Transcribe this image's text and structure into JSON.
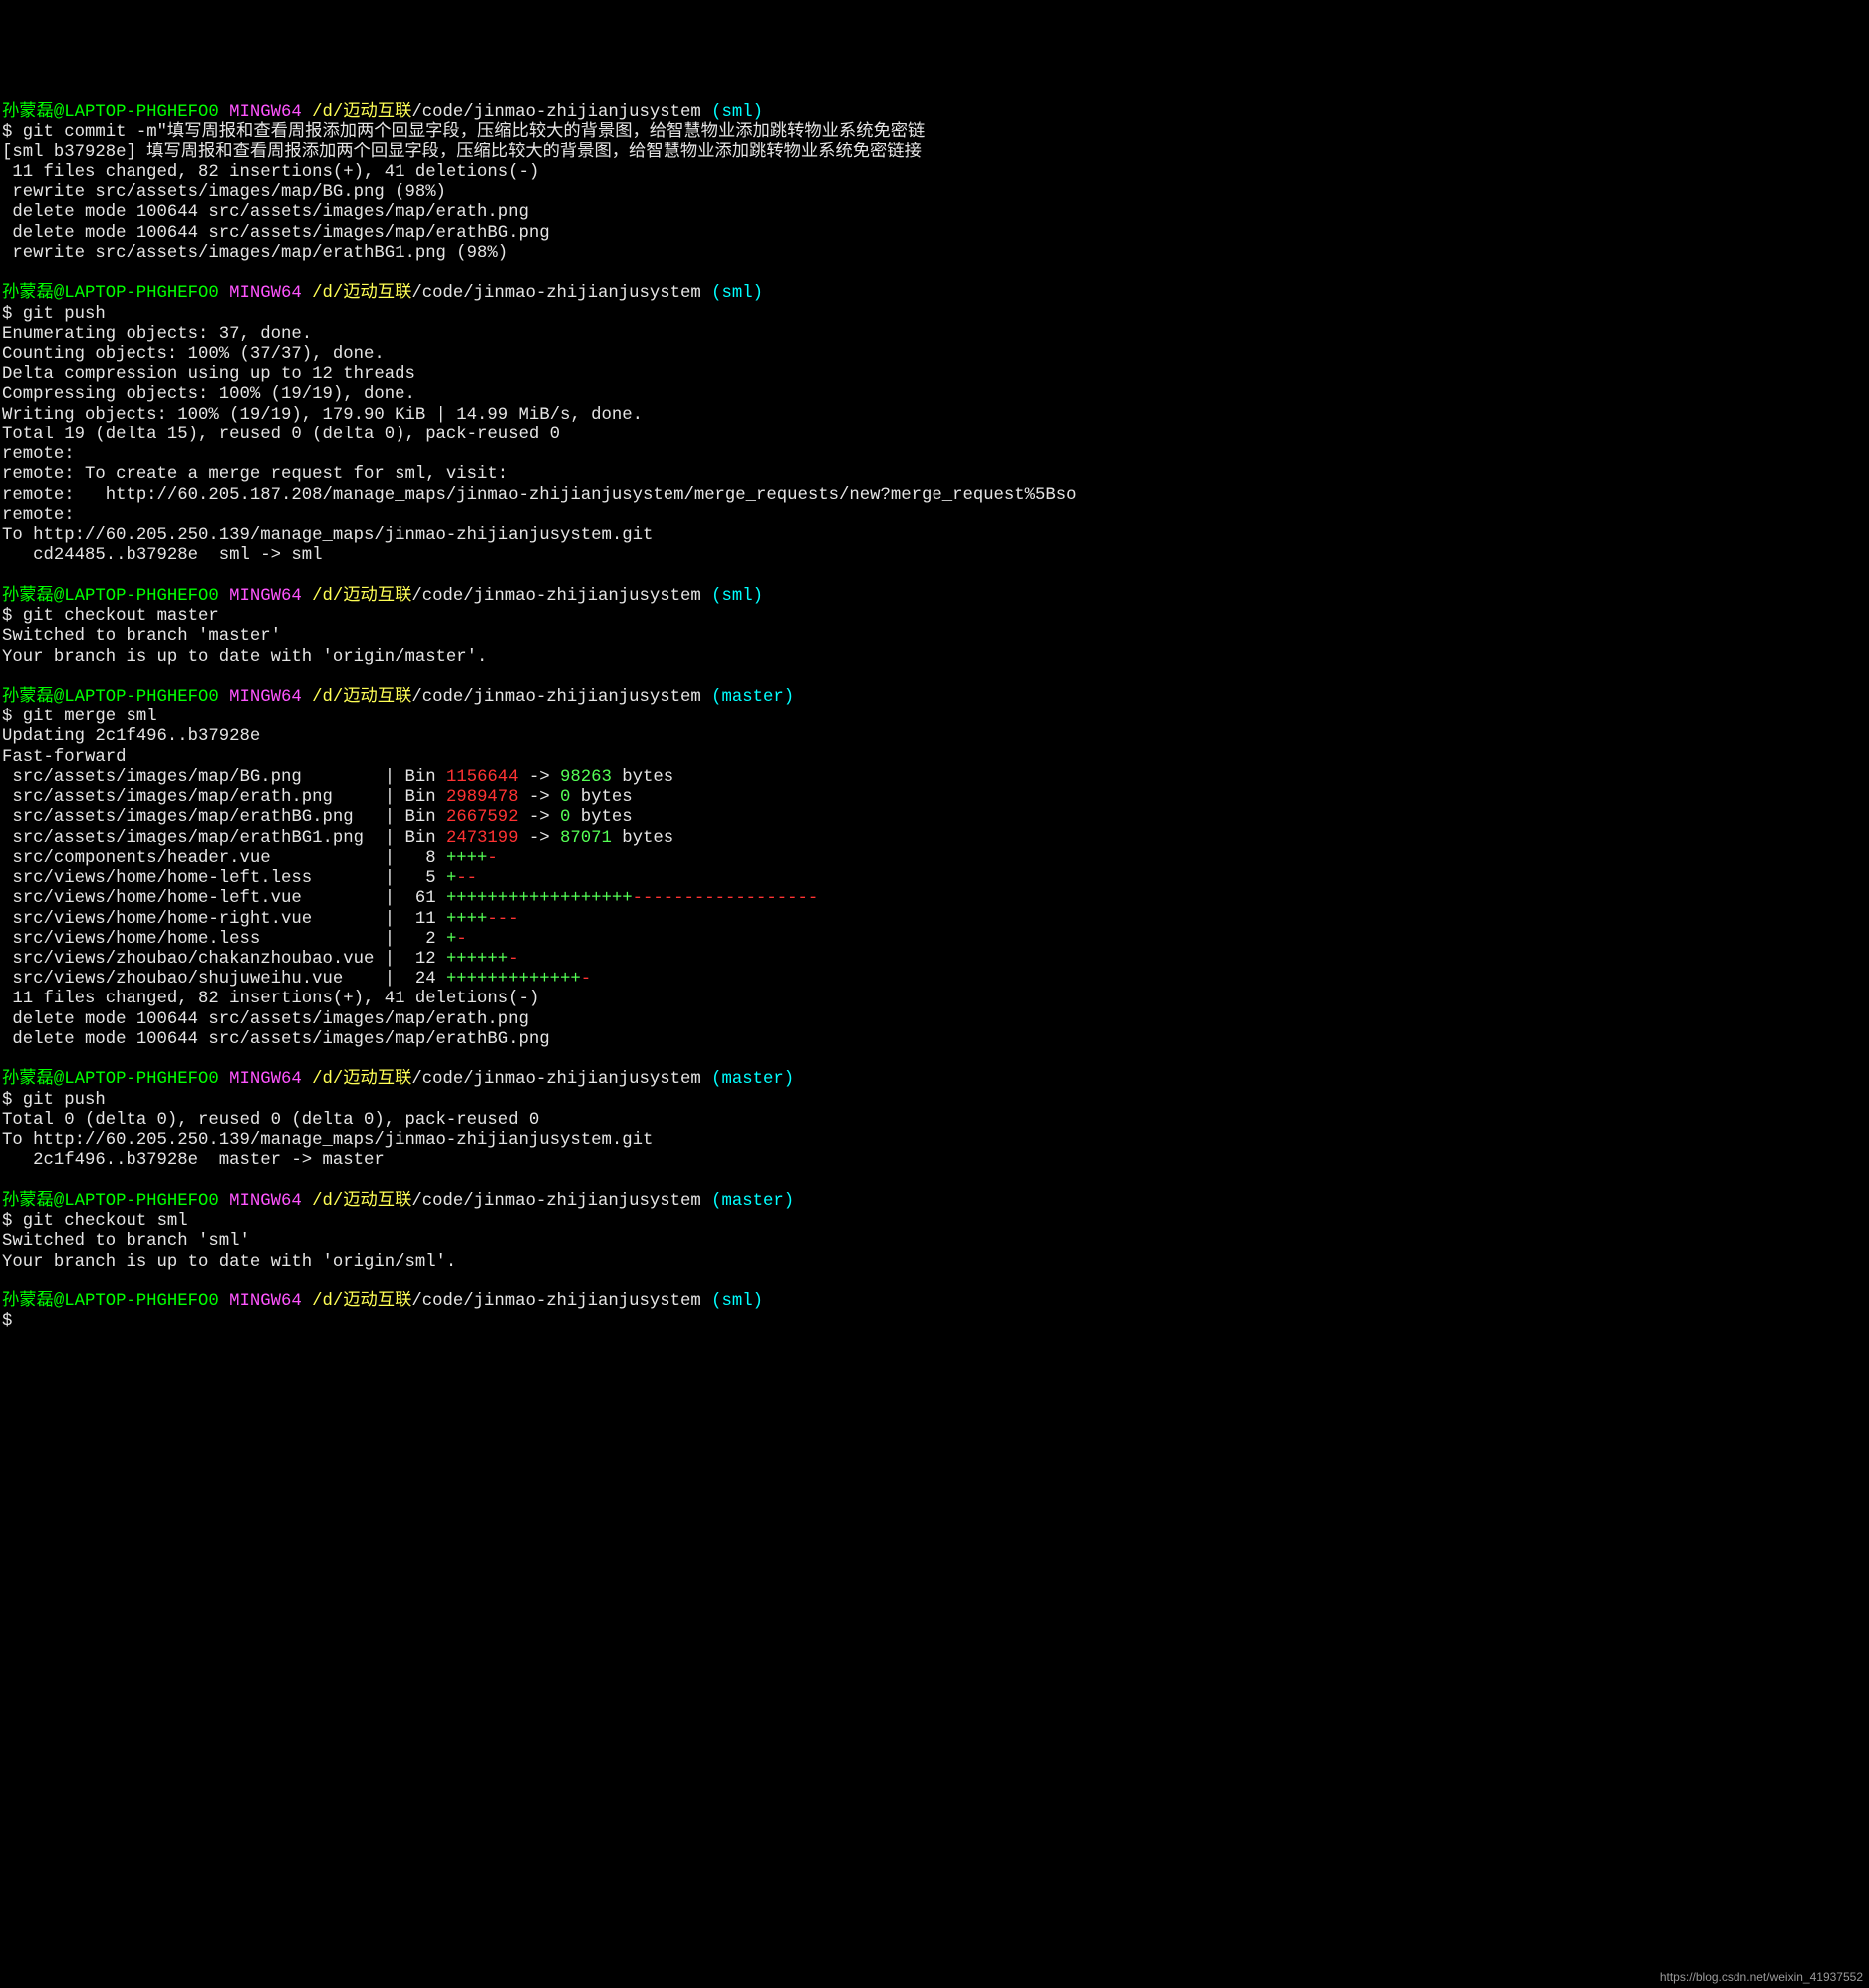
{
  "prompt": {
    "user": "孙蒙磊@LAPTOP-PHGHEFO0",
    "env": "MINGW64",
    "path_prefix": "/d/迈动互联",
    "path_repo": "/code/jinmao-zhijianjusystem",
    "branch_sml": "(sml)",
    "branch_master": "(master)"
  },
  "cmd": {
    "commit": "git commit -m\"填写周报和查看周报添加两个回显字段，压缩比较大的背景图，给智慧物业添加跳转物业系统免密链",
    "push": "git push",
    "checkout_master": "git checkout master",
    "merge": "git merge sml",
    "push2": "git push",
    "checkout_sml": "git checkout sml",
    "empty": ""
  },
  "commit_out": {
    "l1": "[sml b37928e] 填写周报和查看周报添加两个回显字段，压缩比较大的背景图，给智慧物业添加跳转物业系统免密链接",
    "l2": " 11 files changed, 82 insertions(+), 41 deletions(-)",
    "l3": " rewrite src/assets/images/map/BG.png (98%)",
    "l4": " delete mode 100644 src/assets/images/map/erath.png",
    "l5": " delete mode 100644 src/assets/images/map/erathBG.png",
    "l6": " rewrite src/assets/images/map/erathBG1.png (98%)"
  },
  "push_out": {
    "l1": "Enumerating objects: 37, done.",
    "l2": "Counting objects: 100% (37/37), done.",
    "l3": "Delta compression using up to 12 threads",
    "l4": "Compressing objects: 100% (19/19), done.",
    "l5": "Writing objects: 100% (19/19), 179.90 KiB | 14.99 MiB/s, done.",
    "l6": "Total 19 (delta 15), reused 0 (delta 0), pack-reused 0",
    "l7": "remote:",
    "l8": "remote: To create a merge request for sml, visit:",
    "l9": "remote:   http://60.205.187.208/manage_maps/jinmao-zhijianjusystem/merge_requests/new?merge_request%5Bso",
    "l10": "remote:",
    "l11": "To http://60.205.250.139/manage_maps/jinmao-zhijianjusystem.git",
    "l12": "   cd24485..b37928e  sml -> sml"
  },
  "checkout_master_out": {
    "l1": "Switched to branch 'master'",
    "l2": "Your branch is up to date with 'origin/master'."
  },
  "merge_out": {
    "head1": "Updating 2c1f496..b37928e",
    "head2": "Fast-forward",
    "r1": {
      "file": " src/assets/images/map/BG.png        ",
      "bin": "| Bin ",
      "old": "1156644",
      "arrow": " -> ",
      "new": "98263",
      "tail": " bytes"
    },
    "r2": {
      "file": " src/assets/images/map/erath.png     ",
      "bin": "| Bin ",
      "old": "2989478",
      "arrow": " -> ",
      "new": "0",
      "tail": " bytes"
    },
    "r3": {
      "file": " src/assets/images/map/erathBG.png   ",
      "bin": "| Bin ",
      "old": "2667592",
      "arrow": " -> ",
      "new": "0",
      "tail": " bytes"
    },
    "r4": {
      "file": " src/assets/images/map/erathBG1.png  ",
      "bin": "| Bin ",
      "old": "2473199",
      "arrow": " -> ",
      "new": "87071",
      "tail": " bytes"
    },
    "r5": {
      "file": " src/components/header.vue           |   8 ",
      "plus": "++++",
      "minus": "-"
    },
    "r6": {
      "file": " src/views/home/home-left.less       |   5 ",
      "plus": "+",
      "minus": "--"
    },
    "r7": {
      "file": " src/views/home/home-left.vue        |  61 ",
      "plus": "++++++++++++++++++",
      "minus": "------------------"
    },
    "r8": {
      "file": " src/views/home/home-right.vue       |  11 ",
      "plus": "++++",
      "minus": "---"
    },
    "r9": {
      "file": " src/views/home/home.less            |   2 ",
      "plus": "+",
      "minus": "-"
    },
    "r10": {
      "file": " src/views/zhoubao/chakanzhoubao.vue |  12 ",
      "plus": "++++++",
      "minus": "-"
    },
    "r11": {
      "file": " src/views/zhoubao/shujuweihu.vue    |  24 ",
      "plus": "+++++++++++++",
      "minus": "-"
    },
    "sum": " 11 files changed, 82 insertions(+), 41 deletions(-)",
    "d1": " delete mode 100644 src/assets/images/map/erath.png",
    "d2": " delete mode 100644 src/assets/images/map/erathBG.png"
  },
  "push2_out": {
    "l1": "Total 0 (delta 0), reused 0 (delta 0), pack-reused 0",
    "l2": "To http://60.205.250.139/manage_maps/jinmao-zhijianjusystem.git",
    "l3": "   2c1f496..b37928e  master -> master"
  },
  "checkout_sml_out": {
    "l1": "Switched to branch 'sml'",
    "l2": "Your branch is up to date with 'origin/sml'."
  },
  "attribution": "https://blog.csdn.net/weixin_41937552"
}
